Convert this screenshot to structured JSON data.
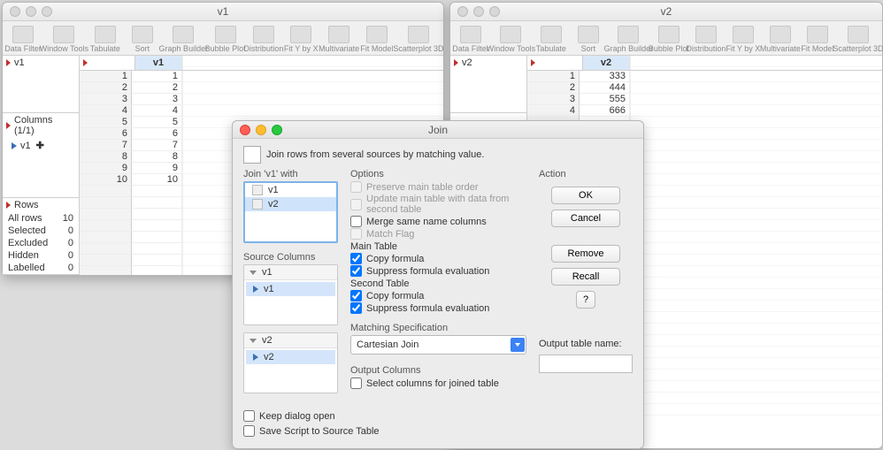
{
  "windows": {
    "left": {
      "title": "v1",
      "toolbar": [
        "Data Filter",
        "Window Tools",
        "Tabulate",
        "Sort",
        "Graph Builder",
        "Bubble Plot",
        "Distribution",
        "Fit Y by X",
        "Multivariate",
        "Fit Model",
        "Scatterplot 3D"
      ],
      "panel_name": "v1",
      "columns_header": "Columns (1/1)",
      "column_item": "v1",
      "rows_header": "Rows",
      "row_stats": [
        {
          "label": "All rows",
          "value": "10"
        },
        {
          "label": "Selected",
          "value": "0"
        },
        {
          "label": "Excluded",
          "value": "0"
        },
        {
          "label": "Hidden",
          "value": "0"
        },
        {
          "label": "Labelled",
          "value": "0"
        }
      ],
      "col_header": "v1",
      "rows": [
        "1",
        "2",
        "3",
        "4",
        "5",
        "6",
        "7",
        "8",
        "9",
        "10"
      ],
      "values": [
        "1",
        "2",
        "3",
        "4",
        "5",
        "6",
        "7",
        "8",
        "9",
        "10"
      ]
    },
    "right": {
      "title": "v2",
      "toolbar": [
        "Data Filter",
        "Window Tools",
        "Tabulate",
        "Sort",
        "Graph Builder",
        "Bubble Plot",
        "Distribution",
        "Fit Y by X",
        "Multivariate",
        "Fit Model",
        "Scatterplot 3D"
      ],
      "panel_name": "v2",
      "col_header": "v2",
      "rows": [
        "1",
        "2",
        "3",
        "4"
      ],
      "values": [
        "333",
        "444",
        "555",
        "666"
      ]
    }
  },
  "dialog": {
    "title": "Join",
    "hint": "Join rows from several sources by matching value.",
    "join_with_label": "Join 'v1' with",
    "join_with_items": [
      "v1",
      "v2"
    ],
    "join_with_selected": "v2",
    "source_columns_label": "Source Columns",
    "source_tables": [
      {
        "name": "v1",
        "cols": [
          "v1"
        ]
      },
      {
        "name": "v2",
        "cols": [
          "v2"
        ]
      }
    ],
    "options_label": "Options",
    "opts": {
      "preserve": "Preserve main table order",
      "update": "Update main table with data from second table",
      "merge": "Merge same name columns",
      "matchflag": "Match Flag",
      "main_table": "Main Table",
      "copy_formula": "Copy formula",
      "suppress": "Suppress formula evaluation",
      "second_table": "Second Table"
    },
    "matching_spec_label": "Matching Specification",
    "matching_selected": "Cartesian Join",
    "output_cols_label": "Output Columns",
    "select_cols": "Select columns for joined table",
    "action_label": "Action",
    "buttons": {
      "ok": "OK",
      "cancel": "Cancel",
      "remove": "Remove",
      "recall": "Recall",
      "help": "?"
    },
    "output_name_label": "Output table name:",
    "keep_open": "Keep dialog open",
    "save_script": "Save Script to Source Table"
  }
}
